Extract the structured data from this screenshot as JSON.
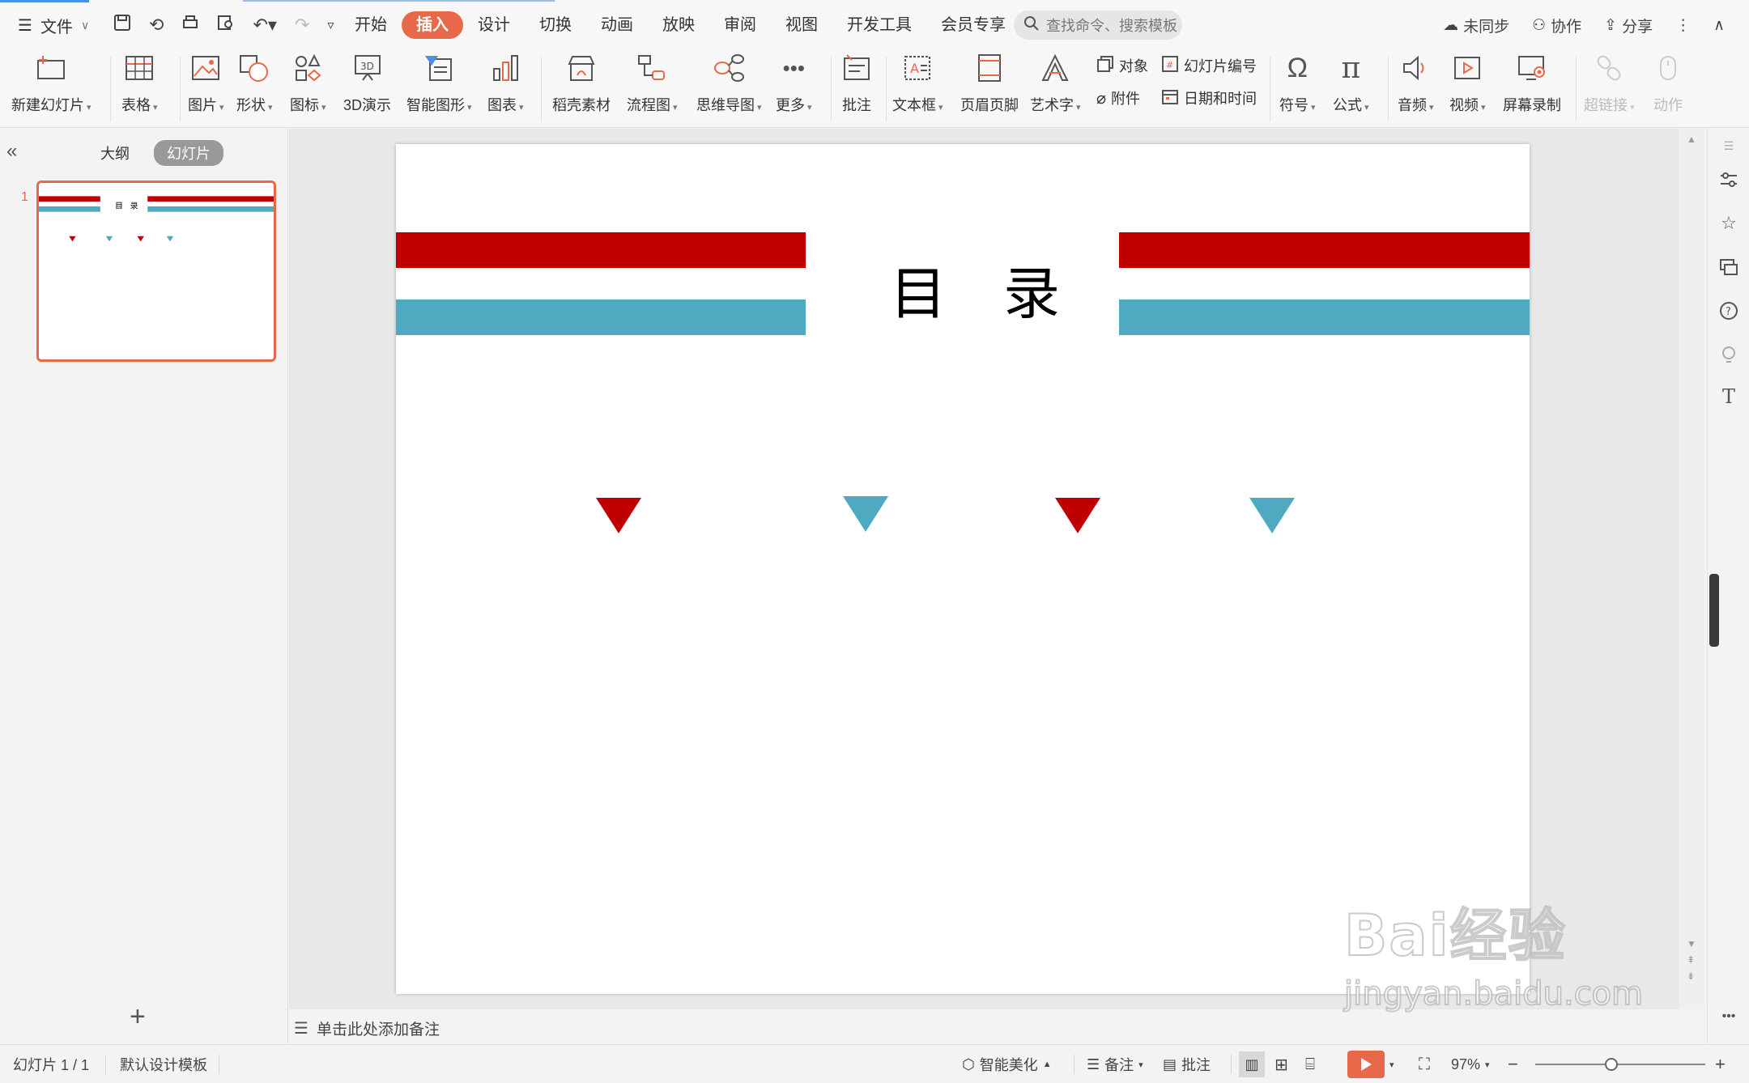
{
  "menu": {
    "file_label": "文件",
    "tabs": [
      "开始",
      "插入",
      "设计",
      "切换",
      "动画",
      "放映",
      "审阅",
      "视图",
      "开发工具",
      "会员专享"
    ],
    "active_tab": "插入",
    "search_placeholder": "查找命令、搜索模板",
    "sync_label": "未同步",
    "collab_label": "协作",
    "share_label": "分享"
  },
  "ribbon": {
    "new_slide": "新建幻灯片",
    "table": "表格",
    "picture": "图片",
    "shape": "形状",
    "icon": "图标",
    "demo3d": "3D演示",
    "smartart": "智能图形",
    "chart": "图表",
    "material": "稻壳素材",
    "flowchart": "流程图",
    "mindmap": "思维导图",
    "more": "更多",
    "comment": "批注",
    "textbox": "文本框",
    "header_footer": "页眉页脚",
    "wordart": "艺术字",
    "object": "对象",
    "attachment": "附件",
    "slide_number": "幻灯片编号",
    "date_time": "日期和时间",
    "symbol": "符号",
    "formula": "公式",
    "audio": "音频",
    "video": "视频",
    "screen_record": "屏幕录制",
    "hyperlink": "超链接",
    "action": "动作"
  },
  "left_panel": {
    "outline_tab": "大纲",
    "slides_tab": "幻灯片",
    "thumb_number": "1"
  },
  "slide": {
    "title": "目　录",
    "colors": {
      "red": "#c00000",
      "teal": "#4fa9c0"
    },
    "triangles": [
      "red",
      "teal",
      "red",
      "teal"
    ]
  },
  "notes_placeholder": "单击此处添加备注",
  "status": {
    "slide_info": "幻灯片 1 / 1",
    "template": "默认设计模板",
    "beautify": "智能美化",
    "notes": "备注",
    "comments": "批注",
    "zoom": "97%"
  },
  "watermark": {
    "brand": "Bai经验",
    "url": "jingyan.baidu.com"
  },
  "colors": {
    "accent": "#e8694a",
    "slide_red": "#c00000",
    "slide_teal": "#4fa9c0"
  }
}
